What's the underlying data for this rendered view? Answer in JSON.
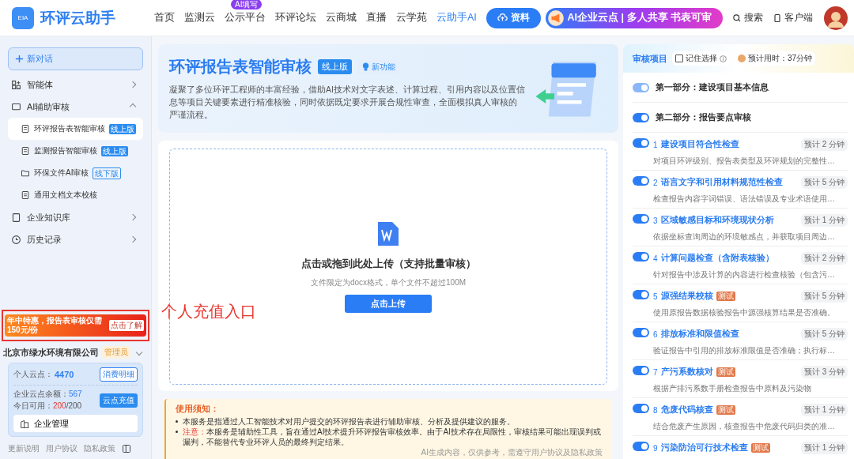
{
  "header": {
    "brand": "环评云助手",
    "logo_text": "EIA",
    "nav": [
      {
        "label": "首页",
        "selected": false
      },
      {
        "label": "监测云",
        "selected": false
      },
      {
        "label": "公示平台",
        "selected": false,
        "badge": "AI填写"
      },
      {
        "label": "环评论坛",
        "selected": false
      },
      {
        "label": "云商城",
        "selected": false
      },
      {
        "label": "直播",
        "selected": false
      },
      {
        "label": "云学苑",
        "selected": false
      },
      {
        "label": "云助手AI",
        "selected": true
      }
    ],
    "resource_button": "资料",
    "promo": "AI企业云点 | 多人共享 书表可审",
    "search": "搜索",
    "client": "客户端"
  },
  "sidebar": {
    "new_chat": "新对话",
    "items": [
      {
        "label": "智能体",
        "expanded": false
      },
      {
        "label": "AI辅助审核",
        "expanded": true,
        "children": [
          {
            "label": "环评报告表智能审核",
            "tag": "线上版",
            "online": true,
            "selected": true
          },
          {
            "label": "监测报告智能审核",
            "tag": "线上版",
            "online": true,
            "selected": false
          },
          {
            "label": "环保文件AI审核",
            "tag": "线下版",
            "online": false,
            "selected": false
          },
          {
            "label": "通用文档文本校核",
            "selected": false
          }
        ]
      },
      {
        "label": "企业知识库",
        "expanded": false
      },
      {
        "label": "历史记录",
        "expanded": false
      }
    ],
    "promo": {
      "text": "年中特惠，报告表审核仅需150元/份",
      "action": "点击了解"
    },
    "company": {
      "name": "北京市绿水环境有限公司",
      "role": "管理员"
    },
    "points": {
      "personal_label": "个人云点：",
      "personal_value": "4470",
      "detail_button": "消费明细",
      "company_label": "企业云点余额：",
      "company_value": "567",
      "today_label": "今日可用：",
      "today_used": "200",
      "today_total": "/200",
      "recharge_button": "云点充值",
      "manage": "企业管理"
    },
    "footer_links": [
      "更新说明",
      "用户协议",
      "隐私政策"
    ]
  },
  "annotation": "个人充值入口",
  "hero": {
    "title": "环评报告表智能审核",
    "version": "线上版",
    "new_badge": "新功能",
    "description": "凝聚了多位环评工程师的丰富经验，借助AI技术对文字表述、计算过程、引用内容以及位置信息等项目关键要素进行精准核验，同时依据既定要求开展合规性审查，全面模拟真人审核的严谨流程。"
  },
  "upload": {
    "title": "点击或拖到此处上传（支持批量审核）",
    "hint": "文件限定为docx格式，单个文件不超过100M",
    "button": "点击上传"
  },
  "notice": {
    "title": "使用须知：",
    "items": [
      {
        "text": "本服务是指通过人工智能技术对用户提交的环评报告表进行辅助审核、分析及提供建议的服务。"
      },
      {
        "lead": "注意：",
        "text": "本服务是辅助性工具，旨在通过AI技术提升环评报告审核效率。由于AI技术存在局限性，审核结果可能出现误判或漏判，不能替代专业环评人员的最终判定结果。"
      }
    ],
    "disclaimer": "AI生成内容，仅供参考，需遵守用户协议及隐私政策"
  },
  "review_panel": {
    "title": "审核项目",
    "remember": {
      "label": "记住选择",
      "checked": false
    },
    "estimate": "预计用时：37分钟",
    "sections": [
      {
        "label": "第一部分：建设项目基本信息",
        "on": true,
        "disabled": true
      },
      {
        "label": "第二部分：报告要点审核",
        "on": true,
        "disabled": false
      }
    ],
    "items": [
      {
        "number": "1",
        "title": "建设项目符合性检查",
        "estimate": "预计 2 分钟",
        "description": "对项目环评级别、报告表类型及环评规划的完整性…",
        "on": true
      },
      {
        "number": "2",
        "title": "语言文字和引用材料规范性检查",
        "estimate": "预计 5 分钟",
        "description": "检查报告内容字词错误、语法错误及专业术语使用…",
        "on": true
      },
      {
        "number": "3",
        "title": "区域敏感目标和环境现状分析",
        "estimate": "预计 1 分钟",
        "description": "依据坐标查询周边的环境敏感点，并获取项目周边…",
        "on": true
      },
      {
        "number": "4",
        "title": "计算问题检查（含附表核验）",
        "estimate": "预计 2 分钟",
        "description": "针对报告中涉及计算的内容进行检查核验（包含污…",
        "on": true
      },
      {
        "number": "5",
        "title": "源强结果校核",
        "tag": "测试",
        "estimate": "预计 5 分钟",
        "description": "使用原报告数据核验报告中源强核算结果是否准确。",
        "on": true
      },
      {
        "number": "6",
        "title": "排放标准和限值检查",
        "estimate": "预计 5 分钟",
        "description": "验证报告中引用的排放标准限值是否准确；执行标…",
        "on": true
      },
      {
        "number": "7",
        "title": "产污系数核对",
        "tag": "测试",
        "estimate": "预计 3 分钟",
        "description": "根据产排污系数手册检查报告中原料及污染物",
        "on": true
      },
      {
        "number": "8",
        "title": "危废代码核查",
        "tag": "测试",
        "estimate": "预计 1 分钟",
        "description": "结合危废产生原因，核查报告中危废代码归类的准…",
        "on": true
      },
      {
        "number": "9",
        "title": "污染防治可行技术检查",
        "tag": "测试",
        "estimate": "预计 1 分钟",
        "on": true
      }
    ]
  }
}
